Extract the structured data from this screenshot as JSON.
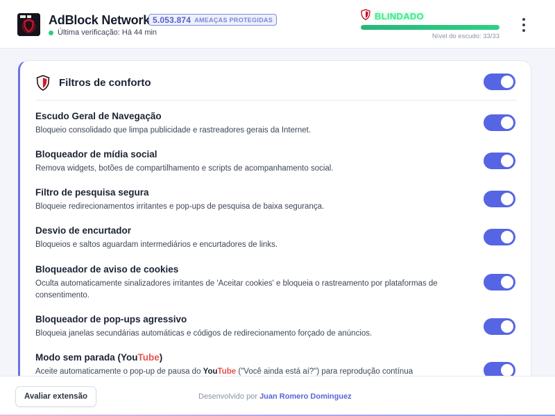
{
  "header": {
    "logo_alt": "AdBlock Network logo",
    "title": "AdBlock Network",
    "threat_count": "5.053.874",
    "threat_label": "AMEAÇAS PROTEGIDAS",
    "last_check": "Última verificação: Há 44 min",
    "shield_status": "BLINDADO",
    "shield_progress": 1.0,
    "shield_level": "Nível do escudo: 33/33"
  },
  "card": {
    "title": "Filtros de conforto",
    "master_enabled": true,
    "items": [
      {
        "title": "Escudo Geral de Navegação",
        "description": "Bloqueio consolidado que limpa publicidade e rastreadores gerais da Internet.",
        "enabled": true
      },
      {
        "title": "Bloqueador de mídia social",
        "description": "Remova widgets, botões de compartilhamento e scripts de acompanhamento social.",
        "enabled": true
      },
      {
        "title": "Filtro de pesquisa segura",
        "description": "Bloqueie redirecionamentos irritantes e pop-ups de pesquisa de baixa segurança.",
        "enabled": true
      },
      {
        "title": "Desvio de encurtador",
        "description": "Bloqueios e saltos aguardam intermediários e encurtadores de links.",
        "enabled": true
      },
      {
        "title": "Bloqueador de aviso de cookies",
        "description": "Oculta automaticamente sinalizadores irritantes de 'Aceitar cookies' e bloqueia o rastreamento por plataformas de consentimento.",
        "enabled": true
      },
      {
        "title": "Bloqueador de pop-ups agressivo",
        "description": "Bloqueia janelas secundárias automáticas e códigos de redirecionamento forçado de anúncios.",
        "enabled": true
      }
    ],
    "last_item": {
      "title_prefix": "Modo sem parada (",
      "title_you": "You",
      "title_tube": "Tube",
      "title_suffix": ")",
      "desc_prefix": "Aceite automaticamente o pop-up de pausa do ",
      "desc_you": "You",
      "desc_tube": "Tube",
      "desc_suffix": " (\"Você ainda está aí?\") para reprodução contínua",
      "enabled": true
    }
  },
  "footer": {
    "rate_label": "Avaliar extensão",
    "credit_prefix": "Desenvolvido por ",
    "credit_author": "Juan Romero Dominguez"
  },
  "colors": {
    "accent": "#5665e4",
    "status_green": "#3fe88d",
    "youtube_red": "#e8514f"
  }
}
